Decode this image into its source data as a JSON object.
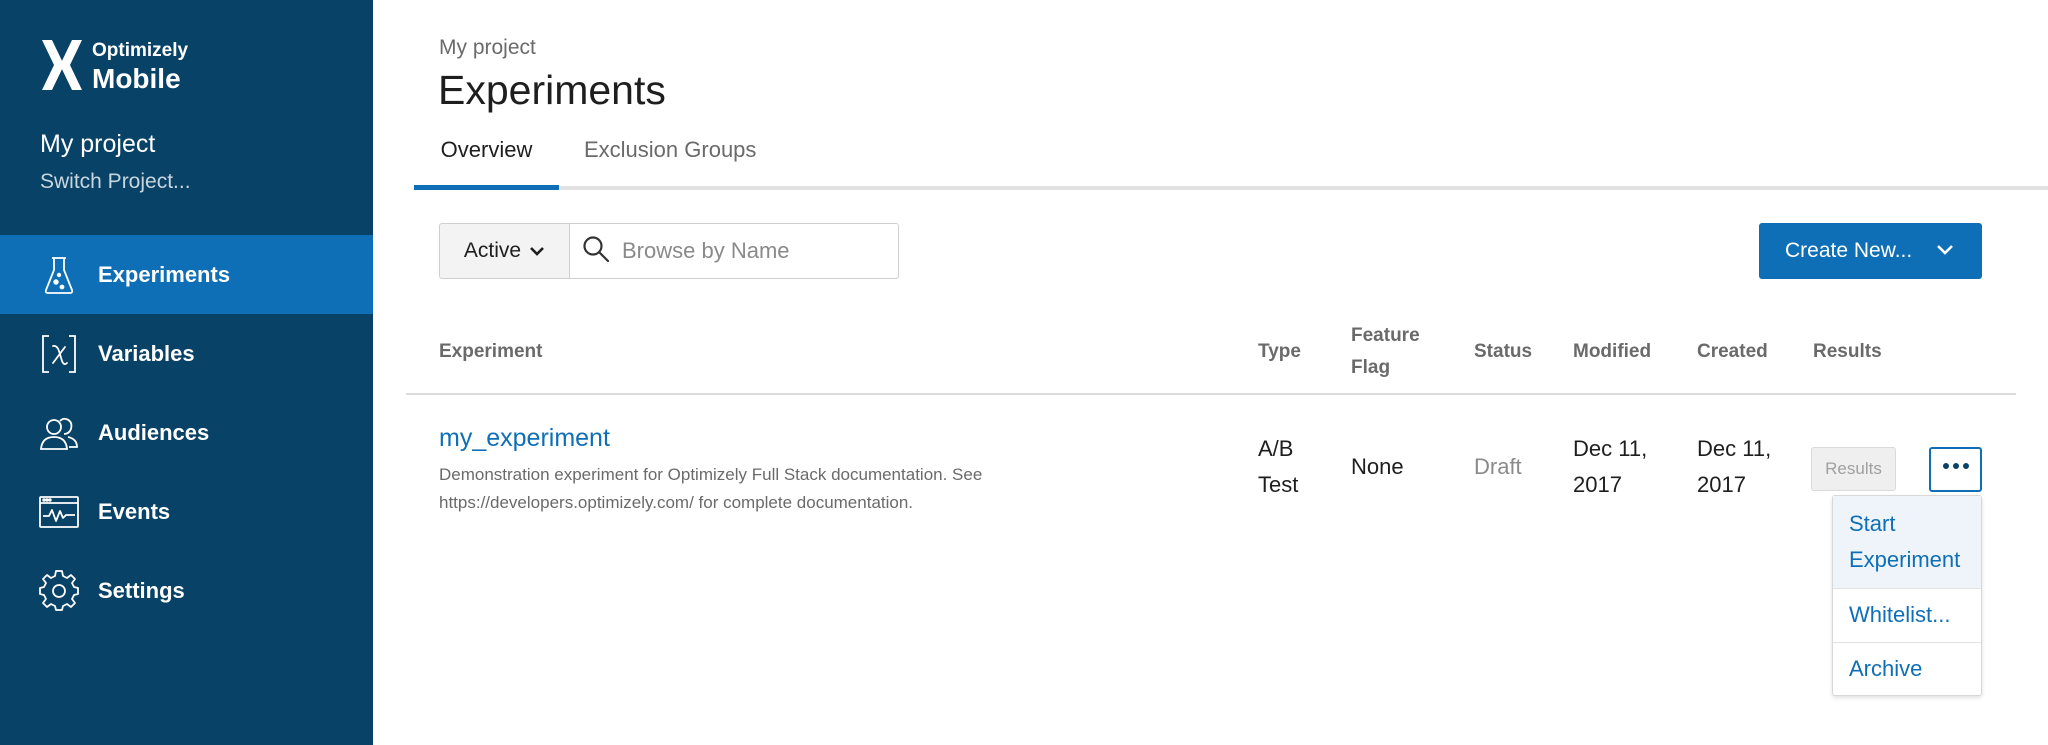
{
  "brand": {
    "name": "Optimizely",
    "product": "Mobile",
    "logo_icon": "optimizely-x-logo"
  },
  "sidebar": {
    "project_name": "My project",
    "switch_project": "Switch Project...",
    "items": [
      {
        "label": "Experiments",
        "icon": "flask-icon",
        "active": true
      },
      {
        "label": "Variables",
        "icon": "variable-icon",
        "active": false
      },
      {
        "label": "Audiences",
        "icon": "audiences-icon",
        "active": false
      },
      {
        "label": "Events",
        "icon": "events-icon",
        "active": false
      },
      {
        "label": "Settings",
        "icon": "gear-icon",
        "active": false
      }
    ]
  },
  "header": {
    "breadcrumb": "My project",
    "title": "Experiments",
    "tabs": [
      {
        "label": "Overview",
        "active": true
      },
      {
        "label": "Exclusion Groups",
        "active": false
      }
    ]
  },
  "filters": {
    "status_selected": "Active",
    "search_placeholder": "Browse by Name",
    "create_label": "Create New..."
  },
  "table": {
    "columns": {
      "experiment": "Experiment",
      "type": "Type",
      "feature_flag_1": "Feature",
      "feature_flag_2": "Flag",
      "status": "Status",
      "modified": "Modified",
      "created": "Created",
      "results": "Results"
    },
    "row": {
      "name": "my_experiment",
      "description_line1": "Demonstration experiment for Optimizely Full Stack documentation. See",
      "description_line2": "https://developers.optimizely.com/ for complete documentation.",
      "type_1": "A/B",
      "type_2": "Test",
      "feature_flag": "None",
      "status": "Draft",
      "modified_1": "Dec 11,",
      "modified_2": "2017",
      "created_1": "Dec 11,",
      "created_2": "2017",
      "results_button": "Results"
    }
  },
  "menu": {
    "start_1": "Start",
    "start_2": "Experiment",
    "whitelist": "Whitelist...",
    "archive": "Archive"
  },
  "colors": {
    "sidebar_bg": "#084267",
    "accent": "#0f6fb6",
    "muted_text": "#6a6a6a"
  }
}
